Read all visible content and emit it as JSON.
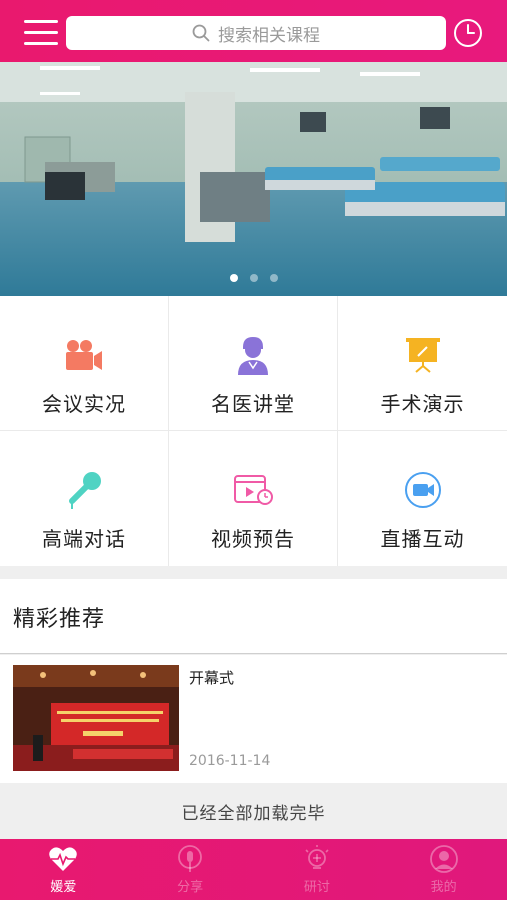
{
  "header": {
    "menu_icon": "hamburger-menu-icon",
    "search_placeholder": "搜索相关课程",
    "search_icon": "search-icon",
    "history_icon": "clock-icon"
  },
  "banner": {
    "image": "hospital-ward-photo",
    "slides": 3,
    "active_slide": 1
  },
  "categories": [
    {
      "label": "会议实况",
      "icon": "video-camera-icon",
      "color": "#f47a62"
    },
    {
      "label": "名医讲堂",
      "icon": "doctor-icon",
      "color": "#8a73d8"
    },
    {
      "label": "手术演示",
      "icon": "presentation-board-icon",
      "color": "#f5b322"
    },
    {
      "label": "高端对话",
      "icon": "microphone-icon",
      "color": "#4fd3c3"
    },
    {
      "label": "视频预告",
      "icon": "video-schedule-icon",
      "color": "#f05aa6"
    },
    {
      "label": "直播互动",
      "icon": "live-camera-icon",
      "color": "#4aa0f0"
    }
  ],
  "recommend": {
    "title": "精彩推荐",
    "items": [
      {
        "title": "开幕式",
        "date": "2016-11-14",
        "thumb": "opening-ceremony-photo"
      }
    ],
    "end_text": "已经全部加载完毕"
  },
  "tabbar": {
    "tabs": [
      {
        "label": "媛爱",
        "icon": "heartbeat-icon",
        "active": true
      },
      {
        "label": "分享",
        "icon": "podcast-icon",
        "active": false
      },
      {
        "label": "研讨",
        "icon": "lightbulb-icon",
        "active": false
      },
      {
        "label": "我的",
        "icon": "user-icon",
        "active": false
      }
    ]
  },
  "colors": {
    "brand": "#e9196e",
    "background": "#efefef"
  }
}
